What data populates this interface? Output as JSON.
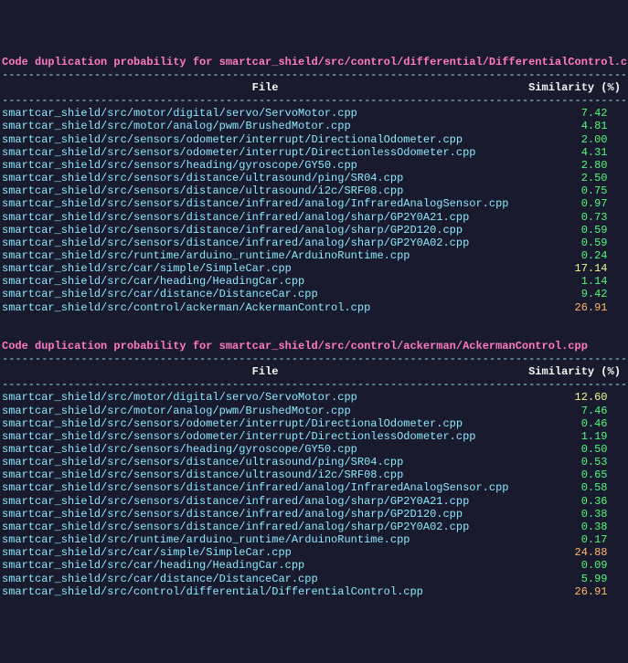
{
  "sections": [
    {
      "title_prefix": "Code duplication probability for ",
      "title_path": "smartcar_shield/src/control/differential/DifferentialControl.cpp",
      "divider": "---------------------------------------------------------------------------------------------------",
      "header_file": "File",
      "header_sim": "Similarity (%)",
      "rows": [
        {
          "file": "smartcar_shield/src/motor/digital/servo/ServoMotor.cpp",
          "sim": "7.42",
          "cls": "sim-low"
        },
        {
          "file": "smartcar_shield/src/motor/analog/pwm/BrushedMotor.cpp",
          "sim": "4.81",
          "cls": "sim-low"
        },
        {
          "file": "smartcar_shield/src/sensors/odometer/interrupt/DirectionalOdometer.cpp",
          "sim": "2.00",
          "cls": "sim-low"
        },
        {
          "file": "smartcar_shield/src/sensors/odometer/interrupt/DirectionlessOdometer.cpp",
          "sim": "4.31",
          "cls": "sim-low"
        },
        {
          "file": "smartcar_shield/src/sensors/heading/gyroscope/GY50.cpp",
          "sim": "2.80",
          "cls": "sim-low"
        },
        {
          "file": "smartcar_shield/src/sensors/distance/ultrasound/ping/SR04.cpp",
          "sim": "2.50",
          "cls": "sim-low"
        },
        {
          "file": "smartcar_shield/src/sensors/distance/ultrasound/i2c/SRF08.cpp",
          "sim": "0.75",
          "cls": "sim-low"
        },
        {
          "file": "smartcar_shield/src/sensors/distance/infrared/analog/InfraredAnalogSensor.cpp",
          "sim": "0.97",
          "cls": "sim-low"
        },
        {
          "file": "smartcar_shield/src/sensors/distance/infrared/analog/sharp/GP2Y0A21.cpp",
          "sim": "0.73",
          "cls": "sim-low"
        },
        {
          "file": "smartcar_shield/src/sensors/distance/infrared/analog/sharp/GP2D120.cpp",
          "sim": "0.59",
          "cls": "sim-low"
        },
        {
          "file": "smartcar_shield/src/sensors/distance/infrared/analog/sharp/GP2Y0A02.cpp",
          "sim": "0.59",
          "cls": "sim-low"
        },
        {
          "file": "smartcar_shield/src/runtime/arduino_runtime/ArduinoRuntime.cpp",
          "sim": "0.24",
          "cls": "sim-low"
        },
        {
          "file": "smartcar_shield/src/car/simple/SimpleCar.cpp",
          "sim": "17.14",
          "cls": "sim-mid"
        },
        {
          "file": "smartcar_shield/src/car/heading/HeadingCar.cpp",
          "sim": "1.14",
          "cls": "sim-low"
        },
        {
          "file": "smartcar_shield/src/car/distance/DistanceCar.cpp",
          "sim": "9.42",
          "cls": "sim-low"
        },
        {
          "file": "smartcar_shield/src/control/ackerman/AckermanControl.cpp",
          "sim": "26.91",
          "cls": "sim-high"
        }
      ]
    },
    {
      "title_prefix": "Code duplication probability for ",
      "title_path": "smartcar_shield/src/control/ackerman/AckermanControl.cpp",
      "divider": "---------------------------------------------------------------------------------------------------",
      "header_file": "File",
      "header_sim": "Similarity (%)",
      "rows": [
        {
          "file": "smartcar_shield/src/motor/digital/servo/ServoMotor.cpp",
          "sim": "12.60",
          "cls": "sim-mid"
        },
        {
          "file": "smartcar_shield/src/motor/analog/pwm/BrushedMotor.cpp",
          "sim": "7.46",
          "cls": "sim-low"
        },
        {
          "file": "smartcar_shield/src/sensors/odometer/interrupt/DirectionalOdometer.cpp",
          "sim": "0.46",
          "cls": "sim-low"
        },
        {
          "file": "smartcar_shield/src/sensors/odometer/interrupt/DirectionlessOdometer.cpp",
          "sim": "1.19",
          "cls": "sim-low"
        },
        {
          "file": "smartcar_shield/src/sensors/heading/gyroscope/GY50.cpp",
          "sim": "0.50",
          "cls": "sim-low"
        },
        {
          "file": "smartcar_shield/src/sensors/distance/ultrasound/ping/SR04.cpp",
          "sim": "0.53",
          "cls": "sim-low"
        },
        {
          "file": "smartcar_shield/src/sensors/distance/ultrasound/i2c/SRF08.cpp",
          "sim": "0.65",
          "cls": "sim-low"
        },
        {
          "file": "smartcar_shield/src/sensors/distance/infrared/analog/InfraredAnalogSensor.cpp",
          "sim": "0.58",
          "cls": "sim-low"
        },
        {
          "file": "smartcar_shield/src/sensors/distance/infrared/analog/sharp/GP2Y0A21.cpp",
          "sim": "0.36",
          "cls": "sim-low"
        },
        {
          "file": "smartcar_shield/src/sensors/distance/infrared/analog/sharp/GP2D120.cpp",
          "sim": "0.38",
          "cls": "sim-low"
        },
        {
          "file": "smartcar_shield/src/sensors/distance/infrared/analog/sharp/GP2Y0A02.cpp",
          "sim": "0.38",
          "cls": "sim-low"
        },
        {
          "file": "smartcar_shield/src/runtime/arduino_runtime/ArduinoRuntime.cpp",
          "sim": "0.17",
          "cls": "sim-low"
        },
        {
          "file": "smartcar_shield/src/car/simple/SimpleCar.cpp",
          "sim": "24.88",
          "cls": "sim-high"
        },
        {
          "file": "smartcar_shield/src/car/heading/HeadingCar.cpp",
          "sim": "0.09",
          "cls": "sim-low"
        },
        {
          "file": "smartcar_shield/src/car/distance/DistanceCar.cpp",
          "sim": "5.99",
          "cls": "sim-low"
        },
        {
          "file": "smartcar_shield/src/control/differential/DifferentialControl.cpp",
          "sim": "26.91",
          "cls": "sim-high"
        }
      ]
    }
  ],
  "col_width_file": 80,
  "col_width_sim": 14
}
